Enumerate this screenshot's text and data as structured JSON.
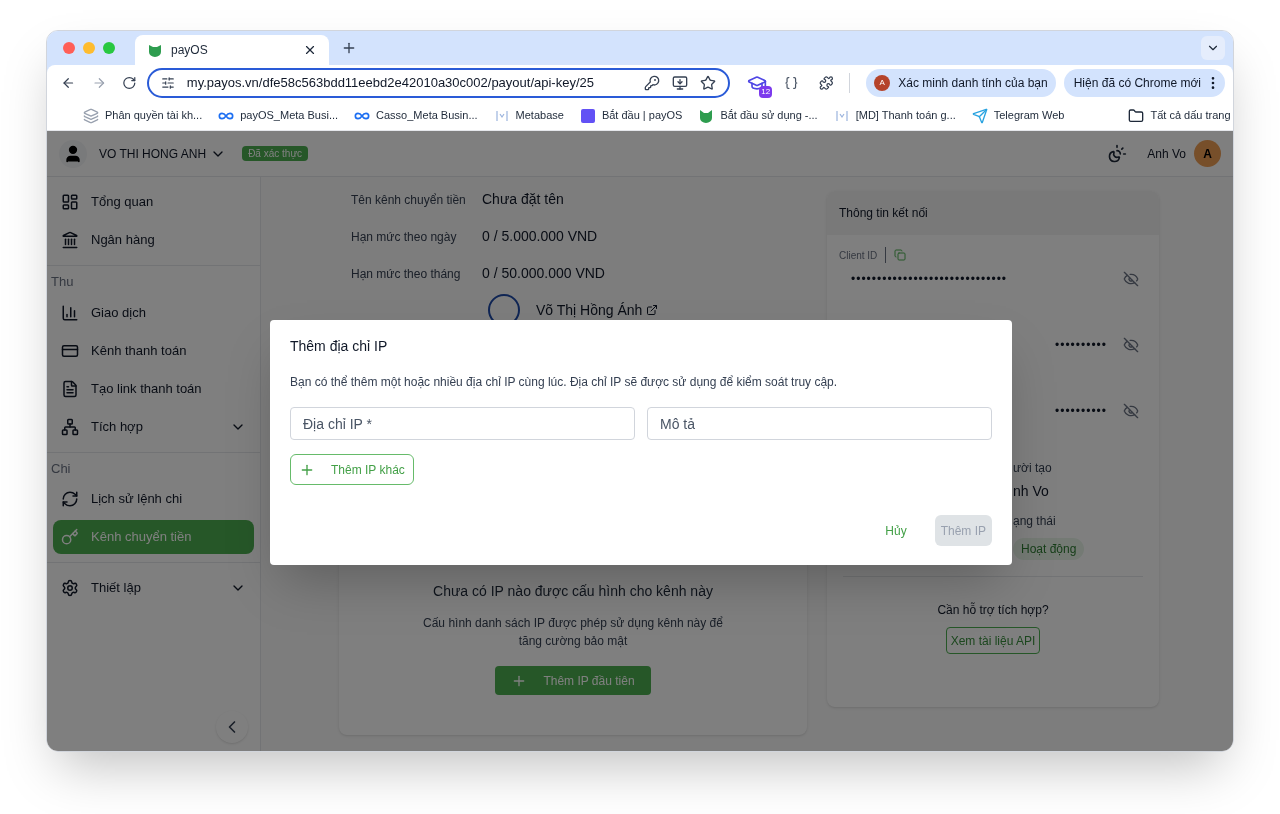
{
  "browser": {
    "tab_title": "payOS",
    "url": "my.payos.vn/dfe58c563bdd11eebd2e42010a30c002/payout/api-key/25",
    "extension_badge": "12",
    "profile_chip": "Xác minh danh tính của bạn",
    "profile_letter": "A",
    "update_chip": "Hiện đã có Chrome mới",
    "bookmarks": [
      {
        "label": "Phân quyền tài kh..."
      },
      {
        "label": "payOS_Meta Busi..."
      },
      {
        "label": "Casso_Meta Busin..."
      },
      {
        "label": "Metabase"
      },
      {
        "label": "Bắt đầu | payOS"
      },
      {
        "label": "Bắt đầu sử dụng -..."
      },
      {
        "label": "[MD] Thanh toán g..."
      },
      {
        "label": "Telegram Web"
      }
    ],
    "all_bookmarks": "Tất cả dấu trang"
  },
  "header": {
    "account_name": "VO THI HONG ANH",
    "verified_badge": "Đã xác thực",
    "user_name": "Anh Vo",
    "avatar_letter": "A"
  },
  "sidebar": {
    "sections": [
      {
        "items": [
          {
            "label": "Tổng quan",
            "selected": false,
            "expandable": false
          },
          {
            "label": "Ngân hàng",
            "selected": false,
            "expandable": false
          }
        ]
      },
      {
        "heading": "Thu",
        "items": [
          {
            "label": "Giao dịch",
            "selected": false,
            "expandable": false
          },
          {
            "label": "Kênh thanh toán",
            "selected": false,
            "expandable": false
          },
          {
            "label": "Tạo link thanh toán",
            "selected": false,
            "expandable": false
          },
          {
            "label": "Tích hợp",
            "selected": false,
            "expandable": true
          }
        ]
      },
      {
        "heading": "Chi",
        "items": [
          {
            "label": "Lịch sử lệnh chi",
            "selected": false,
            "expandable": false
          },
          {
            "label": "Kênh chuyển tiền",
            "selected": true,
            "expandable": false
          }
        ]
      },
      {
        "items": [
          {
            "label": "Thiết lập",
            "selected": false,
            "expandable": true
          }
        ]
      }
    ]
  },
  "channel": {
    "details": [
      {
        "label": "Tên kênh chuyển tiền",
        "value": "Chưa đặt tên"
      },
      {
        "label": "Hạn mức theo ngày",
        "value": "0 / 5.000.000 VND"
      },
      {
        "label": "Hạn mức theo tháng",
        "value": "0 / 50.000.000 VND"
      }
    ],
    "owner": "Võ Thị Hồng Ánh",
    "empty_title": "Chưa có IP nào được cấu hình cho kênh này",
    "empty_description": "Cấu hình danh sách IP được phép sử dụng kênh này để tăng cường bảo mật",
    "add_first_button": "Thêm IP đầu tiên"
  },
  "connection": {
    "title": "Thông tin kết nối",
    "client_id_label": "Client ID",
    "client_id_value": "••••••••••••••••••••••••••••••",
    "hidden_values": [
      "••••••••••",
      "••••••••••"
    ],
    "creator_label": "ười tạo",
    "creator_value": "nh Vo",
    "status_label": "ạng thái",
    "status_badge": "Hoạt động",
    "help_text": "Cần hỗ trợ tích hợp?",
    "docs_button": "Xem tài liệu API"
  },
  "modal": {
    "title": "Thêm địa chỉ IP",
    "description": "Bạn có thể thêm một hoặc nhiều địa chỉ IP cùng lúc. Địa chỉ IP sẽ được sử dụng để kiểm soát truy cập.",
    "fields": [
      {
        "placeholder": "Địa chỉ IP *"
      },
      {
        "placeholder": "Mô tả"
      }
    ],
    "add_button": "Thêm IP khác",
    "cancel_button": "Hủy",
    "submit_button": "Thêm IP",
    "submit_disabled": true
  }
}
